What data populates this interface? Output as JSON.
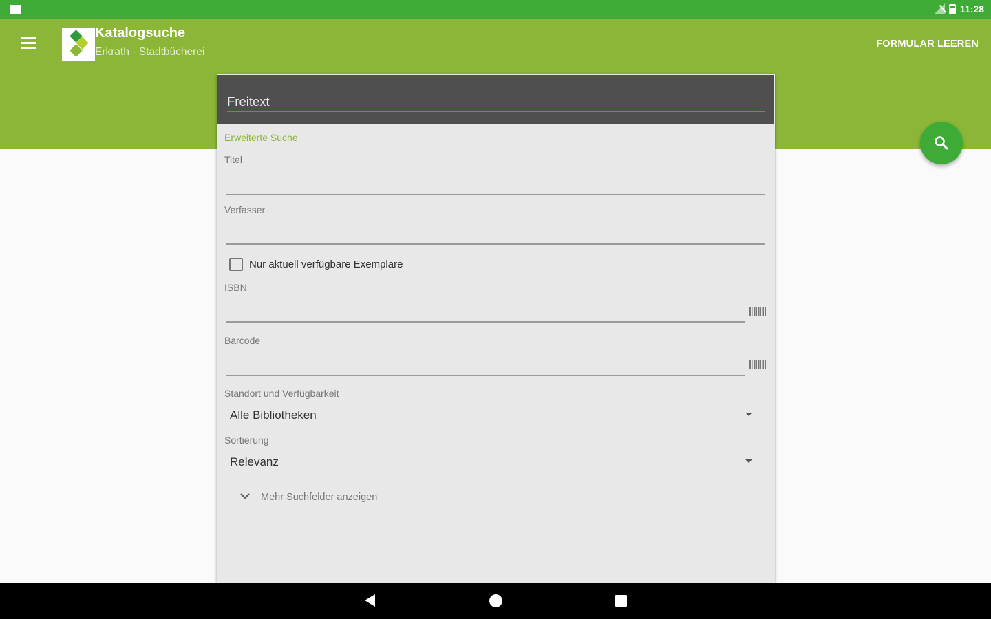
{
  "status_bar": {
    "time": "11:28"
  },
  "app_bar": {
    "title": "Katalogsuche",
    "subtitle": "Erkrath · Stadtbücherei",
    "clear_button_label": "FORMULAR LEEREN",
    "menu_icon": "hamburger-menu-icon",
    "logo": "library-logo",
    "color": "#8bb637"
  },
  "fab": {
    "icon": "search-icon",
    "color": "#3eab37"
  },
  "search_form": {
    "free_text_placeholder": "Freitext",
    "advanced_title": "Erweiterte Suche",
    "fields": {
      "title_label": "Titel",
      "author_label": "Verfasser",
      "isbn_label": "ISBN",
      "barcode_label": "Barcode"
    },
    "available_only": {
      "label": "Nur aktuell verfügbare Exemplare",
      "checked": false
    },
    "location": {
      "label": "Standort und Verfügbarkeit",
      "value": "Alle Bibliotheken"
    },
    "sort": {
      "label": "Sortierung",
      "value": "Relevanz"
    },
    "more_fields_label": "Mehr Suchfelder anzeigen",
    "accent_color": "#3eab37"
  },
  "nav_bar": {
    "back_icon": "back-icon",
    "home_icon": "home-icon",
    "recents_icon": "recents-icon"
  }
}
